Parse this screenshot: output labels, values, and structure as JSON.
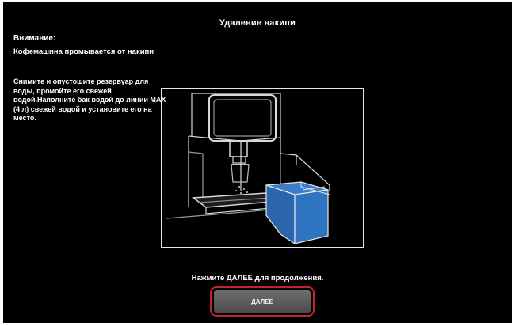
{
  "screen": {
    "title": "Удаление накипи",
    "warning_heading": "Внимание:",
    "warning_text": "Кофемашина промывается от накипи",
    "instructions": "Снимите и опустошите резервуар для воды, промойте его свежей водой.Наполните бак водой до линии MAX (4 л) свежей водой и установите его на место.",
    "prompt": "Нажмите ДАЛЕЕ для продолжения.",
    "next_button_label": "ДАЛЕЕ"
  },
  "colors": {
    "background": "#000000",
    "text": "#ffffff",
    "tank_highlight": "#2f74c0",
    "button_outline": "#c0262b",
    "button_face": "#5c5c5c"
  },
  "icons": {
    "illustration": "coffee-machine-water-tank-illustration"
  }
}
